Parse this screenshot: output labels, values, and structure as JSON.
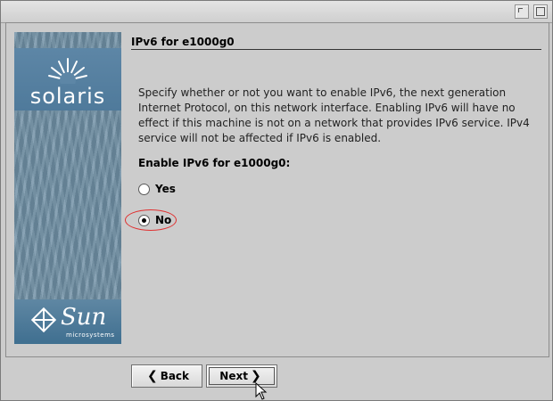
{
  "window": {
    "controls": [
      "minimize",
      "maximize"
    ]
  },
  "branding": {
    "product": "solaris",
    "sun_logo_text": "Sun",
    "sun_subtext": "microsystems"
  },
  "panel": {
    "title": "IPv6 for e1000g0",
    "description": "Specify whether or not you want to enable IPv6, the next generation Internet Protocol, on this network interface.  Enabling IPv6 will have no effect if this machine is not on a network that provides IPv6 service.  IPv4 service will not be affected if IPv6 is enabled.",
    "question": "Enable IPv6 for e1000g0:",
    "options": [
      {
        "label": "Yes",
        "selected": false
      },
      {
        "label": "No",
        "selected": true
      }
    ]
  },
  "footer": {
    "back_label": "Back",
    "next_label": "Next",
    "back_icon": "chevron-left-icon",
    "next_icon": "chevron-right-icon"
  },
  "colors": {
    "background": "#cccccc",
    "sidebar": "#6f8fa4",
    "highlight": "#e03030"
  }
}
